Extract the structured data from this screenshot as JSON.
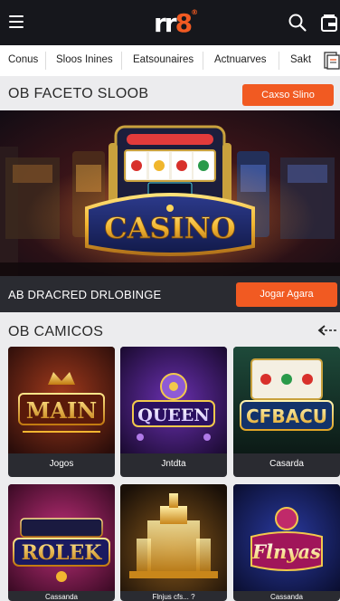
{
  "header": {
    "logo_main": "rr",
    "logo_accent": "8",
    "logo_mark": "®",
    "menu_icon": "hamburger-menu-icon",
    "search_icon": "search-icon",
    "wallet_icon": "wallet-icon",
    "brand_color": "#f15a22"
  },
  "categories": [
    "Conus",
    "Sloos Inines",
    "Eatsounaires",
    "Actnuarves",
    "Sakt"
  ],
  "section_one": {
    "title": "OB FACETO SLOOB",
    "button_label": "Caxso Slino"
  },
  "hero": {
    "logo_text": "CASINO"
  },
  "section_two": {
    "title": "AB DRACRED DRLOBINGE",
    "button_label": "Jogar Agara"
  },
  "section_three": {
    "title": "OB CAMICOS",
    "arrow_icon": "arrow-left-icon",
    "games": [
      {
        "art_text": "MAIN",
        "label": "Jogos"
      },
      {
        "art_text": "QUEEN",
        "label": "Jntdta"
      },
      {
        "art_text": "CFBACU",
        "label": "Casarda"
      },
      {
        "art_text": "ROLEK",
        "label": "Cassanda"
      },
      {
        "art_text": "",
        "label": "Flnjus cfs... ?"
      },
      {
        "art_text": "Flnyas",
        "label": "Cassanda"
      }
    ]
  }
}
